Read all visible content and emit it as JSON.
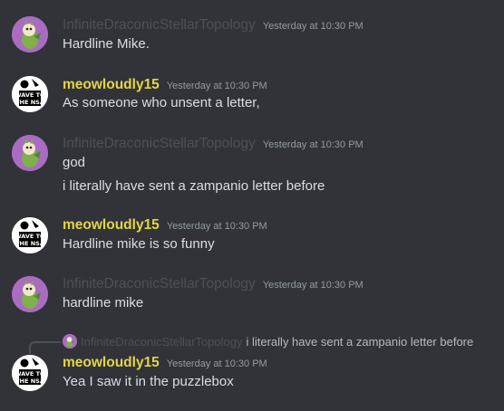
{
  "messages": [
    {
      "author": "InfiniteDraconicStellarTopology",
      "timestamp": "Yesterday at 10:30 PM",
      "lines": [
        "Hardline Mike."
      ]
    },
    {
      "author": "meowloudly15",
      "timestamp": "Yesterday at 10:30 PM",
      "lines": [
        "As someone who unsent a letter,"
      ]
    },
    {
      "author": "InfiniteDraconicStellarTopology",
      "timestamp": "Yesterday at 10:30 PM",
      "lines": [
        "god",
        "i literally have sent a zampanio letter before"
      ]
    },
    {
      "author": "meowloudly15",
      "timestamp": "Yesterday at 10:30 PM",
      "lines": [
        "Hardline mike is so funny"
      ]
    },
    {
      "author": "InfiniteDraconicStellarTopology",
      "timestamp": "Yesterday at 10:30 PM",
      "lines": [
        "hardline mike"
      ]
    },
    {
      "author": "meowloudly15",
      "timestamp": "Yesterday at 10:30 PM",
      "lines": [
        "Yea I saw it in the puzzlebox"
      ],
      "reply": {
        "author": "InfiniteDraconicStellarTopology",
        "text": "i literally have sent a zampanio letter before"
      }
    }
  ],
  "avatar_text": "WAVE TO THE NSA",
  "colors": {
    "background": "#313338",
    "dim_author": "#4e5058",
    "highlight_author": "#e3d548",
    "timestamp": "#949ba4",
    "message_text": "#dbdee1",
    "avatar_purple": "#a96cc0"
  },
  "icons": {
    "user_a_avatar": "green-bird-avatar-icon",
    "user_b_avatar": "wave-to-the-nsa-avatar-icon"
  }
}
